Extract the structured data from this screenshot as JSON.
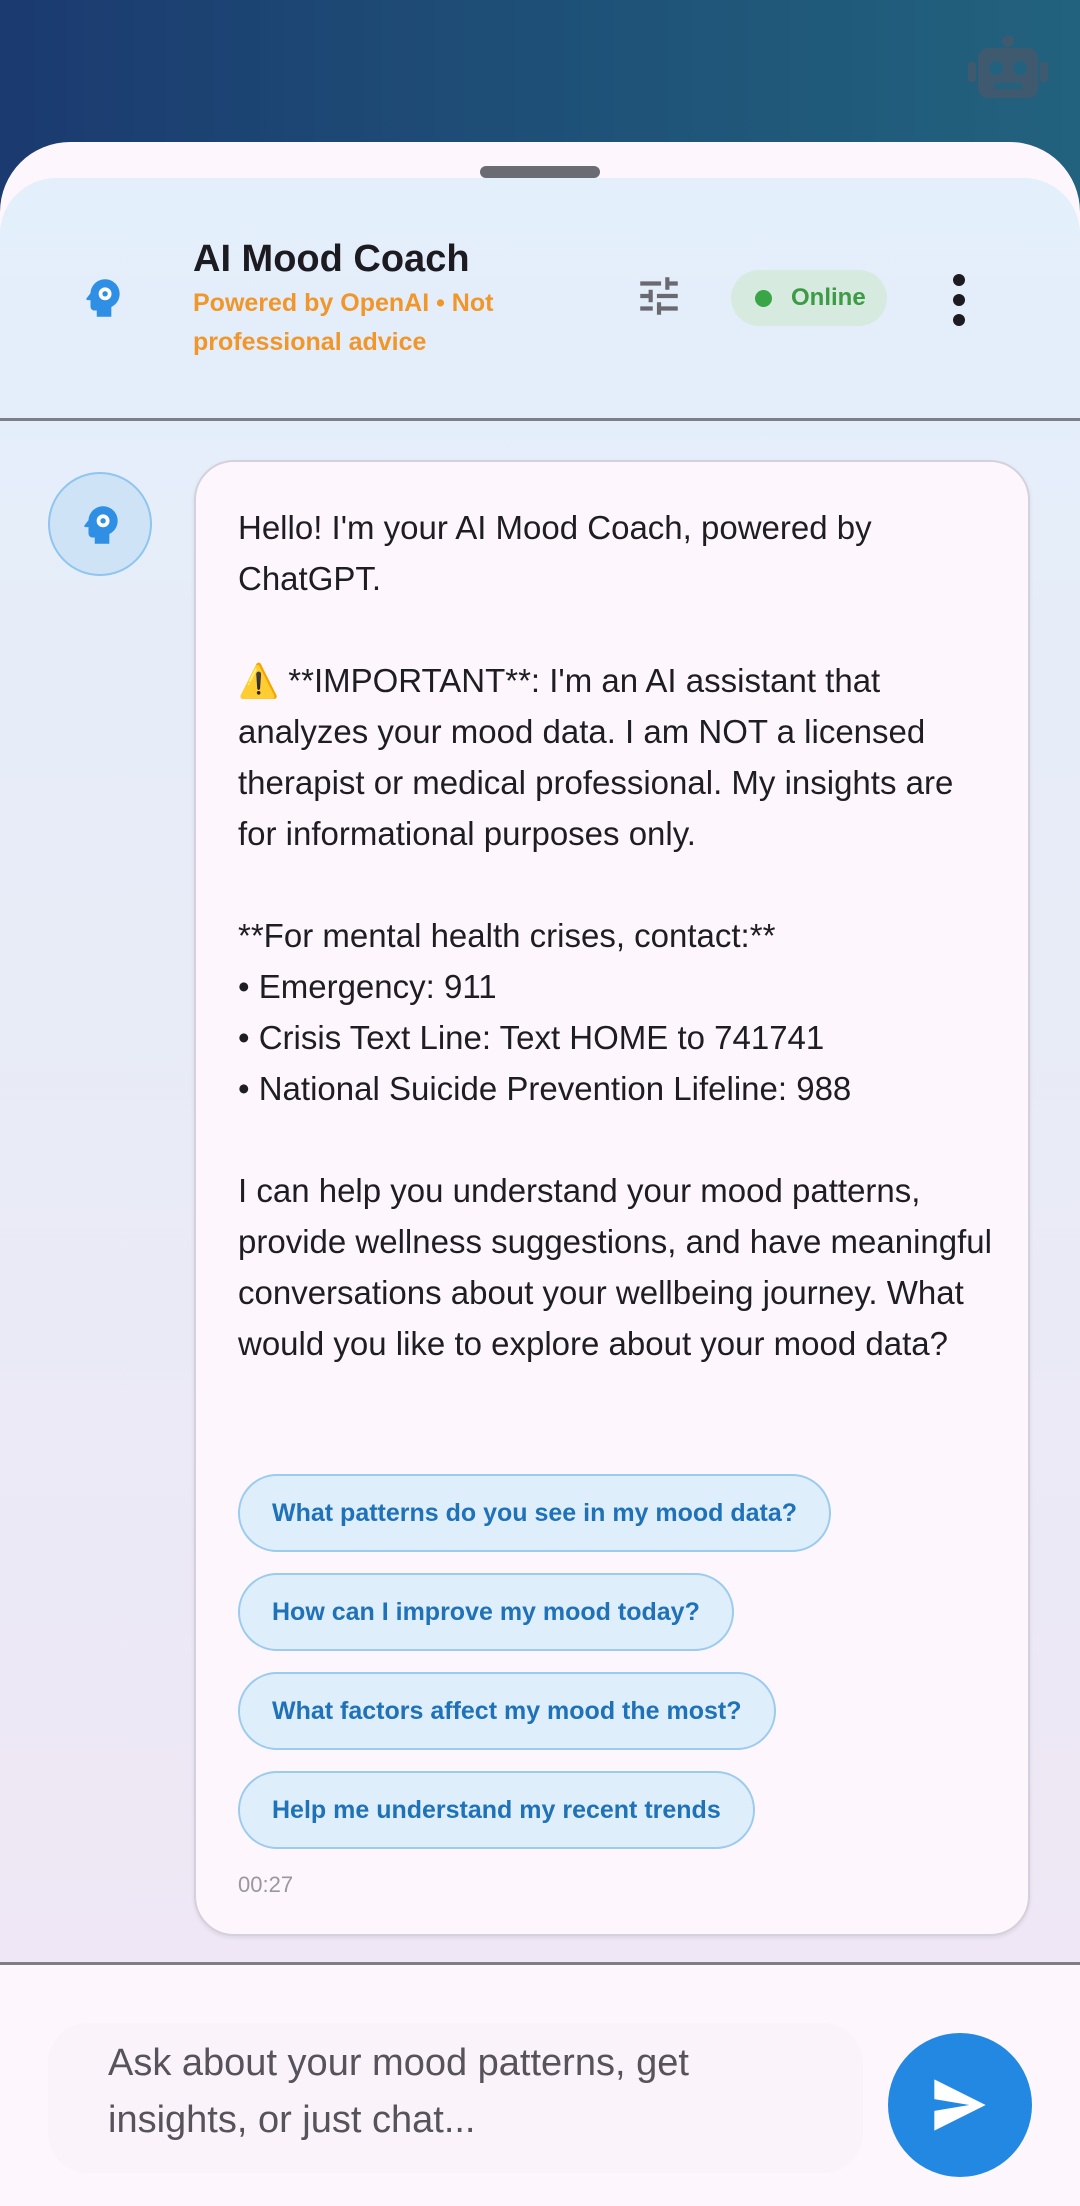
{
  "header": {
    "title": "AI Mood Coach",
    "subtitle": "Powered by OpenAI • Not professional advice",
    "status": "Online"
  },
  "message": {
    "text": "Hello! I'm your AI Mood Coach, powered by ChatGPT.\n\n⚠️ **IMPORTANT**: I'm an AI assistant that analyzes your mood data. I am NOT a licensed therapist or medical professional. My insights are for informational purposes only.\n\n**For mental health crises, contact:**\n• Emergency: 911\n• Crisis Text Line: Text HOME to 741741\n• National Suicide Prevention Lifeline: 988\n\nI can help you understand your mood patterns, provide wellness suggestions, and have meaningful conversations about your wellbeing journey. What would you like to explore about your mood data?",
    "suggestions": [
      "What patterns do you see in my mood data?",
      "How can I improve my mood today?",
      "What factors affect my mood the most?",
      "Help me understand my recent trends"
    ],
    "time": "00:27"
  },
  "input": {
    "placeholder": "Ask about your mood patterns, get insights, or just chat..."
  },
  "icons": {
    "top_right": "robot-icon",
    "header": "psychology-icon",
    "tune": "tune-icon",
    "more": "more-vert-icon",
    "send": "send-icon"
  },
  "colors": {
    "accent": "#2388e2",
    "subtitle": "#f0962a",
    "online": "#3aa546"
  }
}
